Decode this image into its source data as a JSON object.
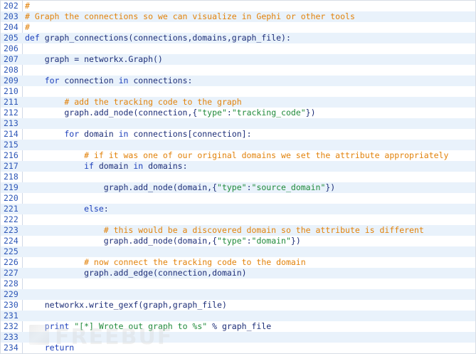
{
  "editor": {
    "lines": [
      {
        "n": "202",
        "segments": [
          {
            "t": "#",
            "c": "comment"
          }
        ]
      },
      {
        "n": "203",
        "segments": [
          {
            "t": "# Graph the connections so we can visualize in Gephi or other tools",
            "c": "comment"
          }
        ]
      },
      {
        "n": "204",
        "segments": [
          {
            "t": "#",
            "c": "comment"
          }
        ]
      },
      {
        "n": "205",
        "segments": [
          {
            "t": "def ",
            "c": "keyword"
          },
          {
            "t": "graph_connections(connections,domains,graph_file):",
            "c": "normal"
          }
        ]
      },
      {
        "n": "206",
        "segments": []
      },
      {
        "n": "207",
        "segments": [
          {
            "t": "    graph = networkx.Graph()",
            "c": "normal"
          }
        ]
      },
      {
        "n": "208",
        "segments": []
      },
      {
        "n": "209",
        "segments": [
          {
            "t": "    for ",
            "c": "keyword"
          },
          {
            "t": "connection ",
            "c": "normal"
          },
          {
            "t": "in ",
            "c": "keyword"
          },
          {
            "t": "connections:",
            "c": "normal"
          }
        ]
      },
      {
        "n": "210",
        "segments": []
      },
      {
        "n": "211",
        "segments": [
          {
            "t": "        # add the tracking code to the graph",
            "c": "comment"
          }
        ]
      },
      {
        "n": "212",
        "segments": [
          {
            "t": "        graph.add_node(connection,{",
            "c": "normal"
          },
          {
            "t": "\"type\"",
            "c": "string"
          },
          {
            "t": ":",
            "c": "normal"
          },
          {
            "t": "\"tracking_code\"",
            "c": "string"
          },
          {
            "t": "})",
            "c": "normal"
          }
        ]
      },
      {
        "n": "213",
        "segments": []
      },
      {
        "n": "214",
        "segments": [
          {
            "t": "        for ",
            "c": "keyword"
          },
          {
            "t": "domain ",
            "c": "normal"
          },
          {
            "t": "in ",
            "c": "keyword"
          },
          {
            "t": "connections[connection]:",
            "c": "normal"
          }
        ]
      },
      {
        "n": "215",
        "segments": []
      },
      {
        "n": "216",
        "segments": [
          {
            "t": "            # if it was one of our original domains we set the attribute appropriately",
            "c": "comment"
          }
        ]
      },
      {
        "n": "217",
        "segments": [
          {
            "t": "            if ",
            "c": "keyword"
          },
          {
            "t": "domain ",
            "c": "normal"
          },
          {
            "t": "in ",
            "c": "keyword"
          },
          {
            "t": "domains:",
            "c": "normal"
          }
        ]
      },
      {
        "n": "218",
        "segments": []
      },
      {
        "n": "219",
        "segments": [
          {
            "t": "                graph.add_node(domain,{",
            "c": "normal"
          },
          {
            "t": "\"type\"",
            "c": "string"
          },
          {
            "t": ":",
            "c": "normal"
          },
          {
            "t": "\"source_domain\"",
            "c": "string"
          },
          {
            "t": "})",
            "c": "normal"
          }
        ]
      },
      {
        "n": "220",
        "segments": []
      },
      {
        "n": "221",
        "segments": [
          {
            "t": "            else",
            "c": "keyword"
          },
          {
            "t": ":",
            "c": "normal"
          }
        ]
      },
      {
        "n": "222",
        "segments": []
      },
      {
        "n": "223",
        "segments": [
          {
            "t": "                # this would be a discovered domain so the attribute is different",
            "c": "comment"
          }
        ]
      },
      {
        "n": "224",
        "segments": [
          {
            "t": "                graph.add_node(domain,{",
            "c": "normal"
          },
          {
            "t": "\"type\"",
            "c": "string"
          },
          {
            "t": ":",
            "c": "normal"
          },
          {
            "t": "\"domain\"",
            "c": "string"
          },
          {
            "t": "})",
            "c": "normal"
          }
        ]
      },
      {
        "n": "225",
        "segments": []
      },
      {
        "n": "226",
        "segments": [
          {
            "t": "            # now connect the tracking code to the domain",
            "c": "comment"
          }
        ]
      },
      {
        "n": "227",
        "segments": [
          {
            "t": "            graph.add_edge(connection,domain)",
            "c": "normal"
          }
        ]
      },
      {
        "n": "228",
        "segments": []
      },
      {
        "n": "229",
        "segments": []
      },
      {
        "n": "230",
        "segments": [
          {
            "t": "    networkx.write_gexf(graph,graph_file)",
            "c": "normal"
          }
        ]
      },
      {
        "n": "231",
        "segments": []
      },
      {
        "n": "232",
        "segments": [
          {
            "t": "    print ",
            "c": "keyword"
          },
          {
            "t": "\"[*] Wrote out graph to %s\"",
            "c": "string"
          },
          {
            "t": " % graph_file",
            "c": "normal"
          }
        ]
      },
      {
        "n": "233",
        "segments": []
      },
      {
        "n": "234",
        "segments": [
          {
            "t": "    return",
            "c": "keyword"
          }
        ]
      }
    ]
  },
  "watermark": {
    "text": "FREEBUF"
  },
  "colors": {
    "comment": "#e2820a",
    "keyword": "#1c3fbb",
    "string": "#1f8a3a",
    "normal": "#1d2e78",
    "line_number": "#2e57b7",
    "alt_row_bg": "#e9f2fb"
  }
}
